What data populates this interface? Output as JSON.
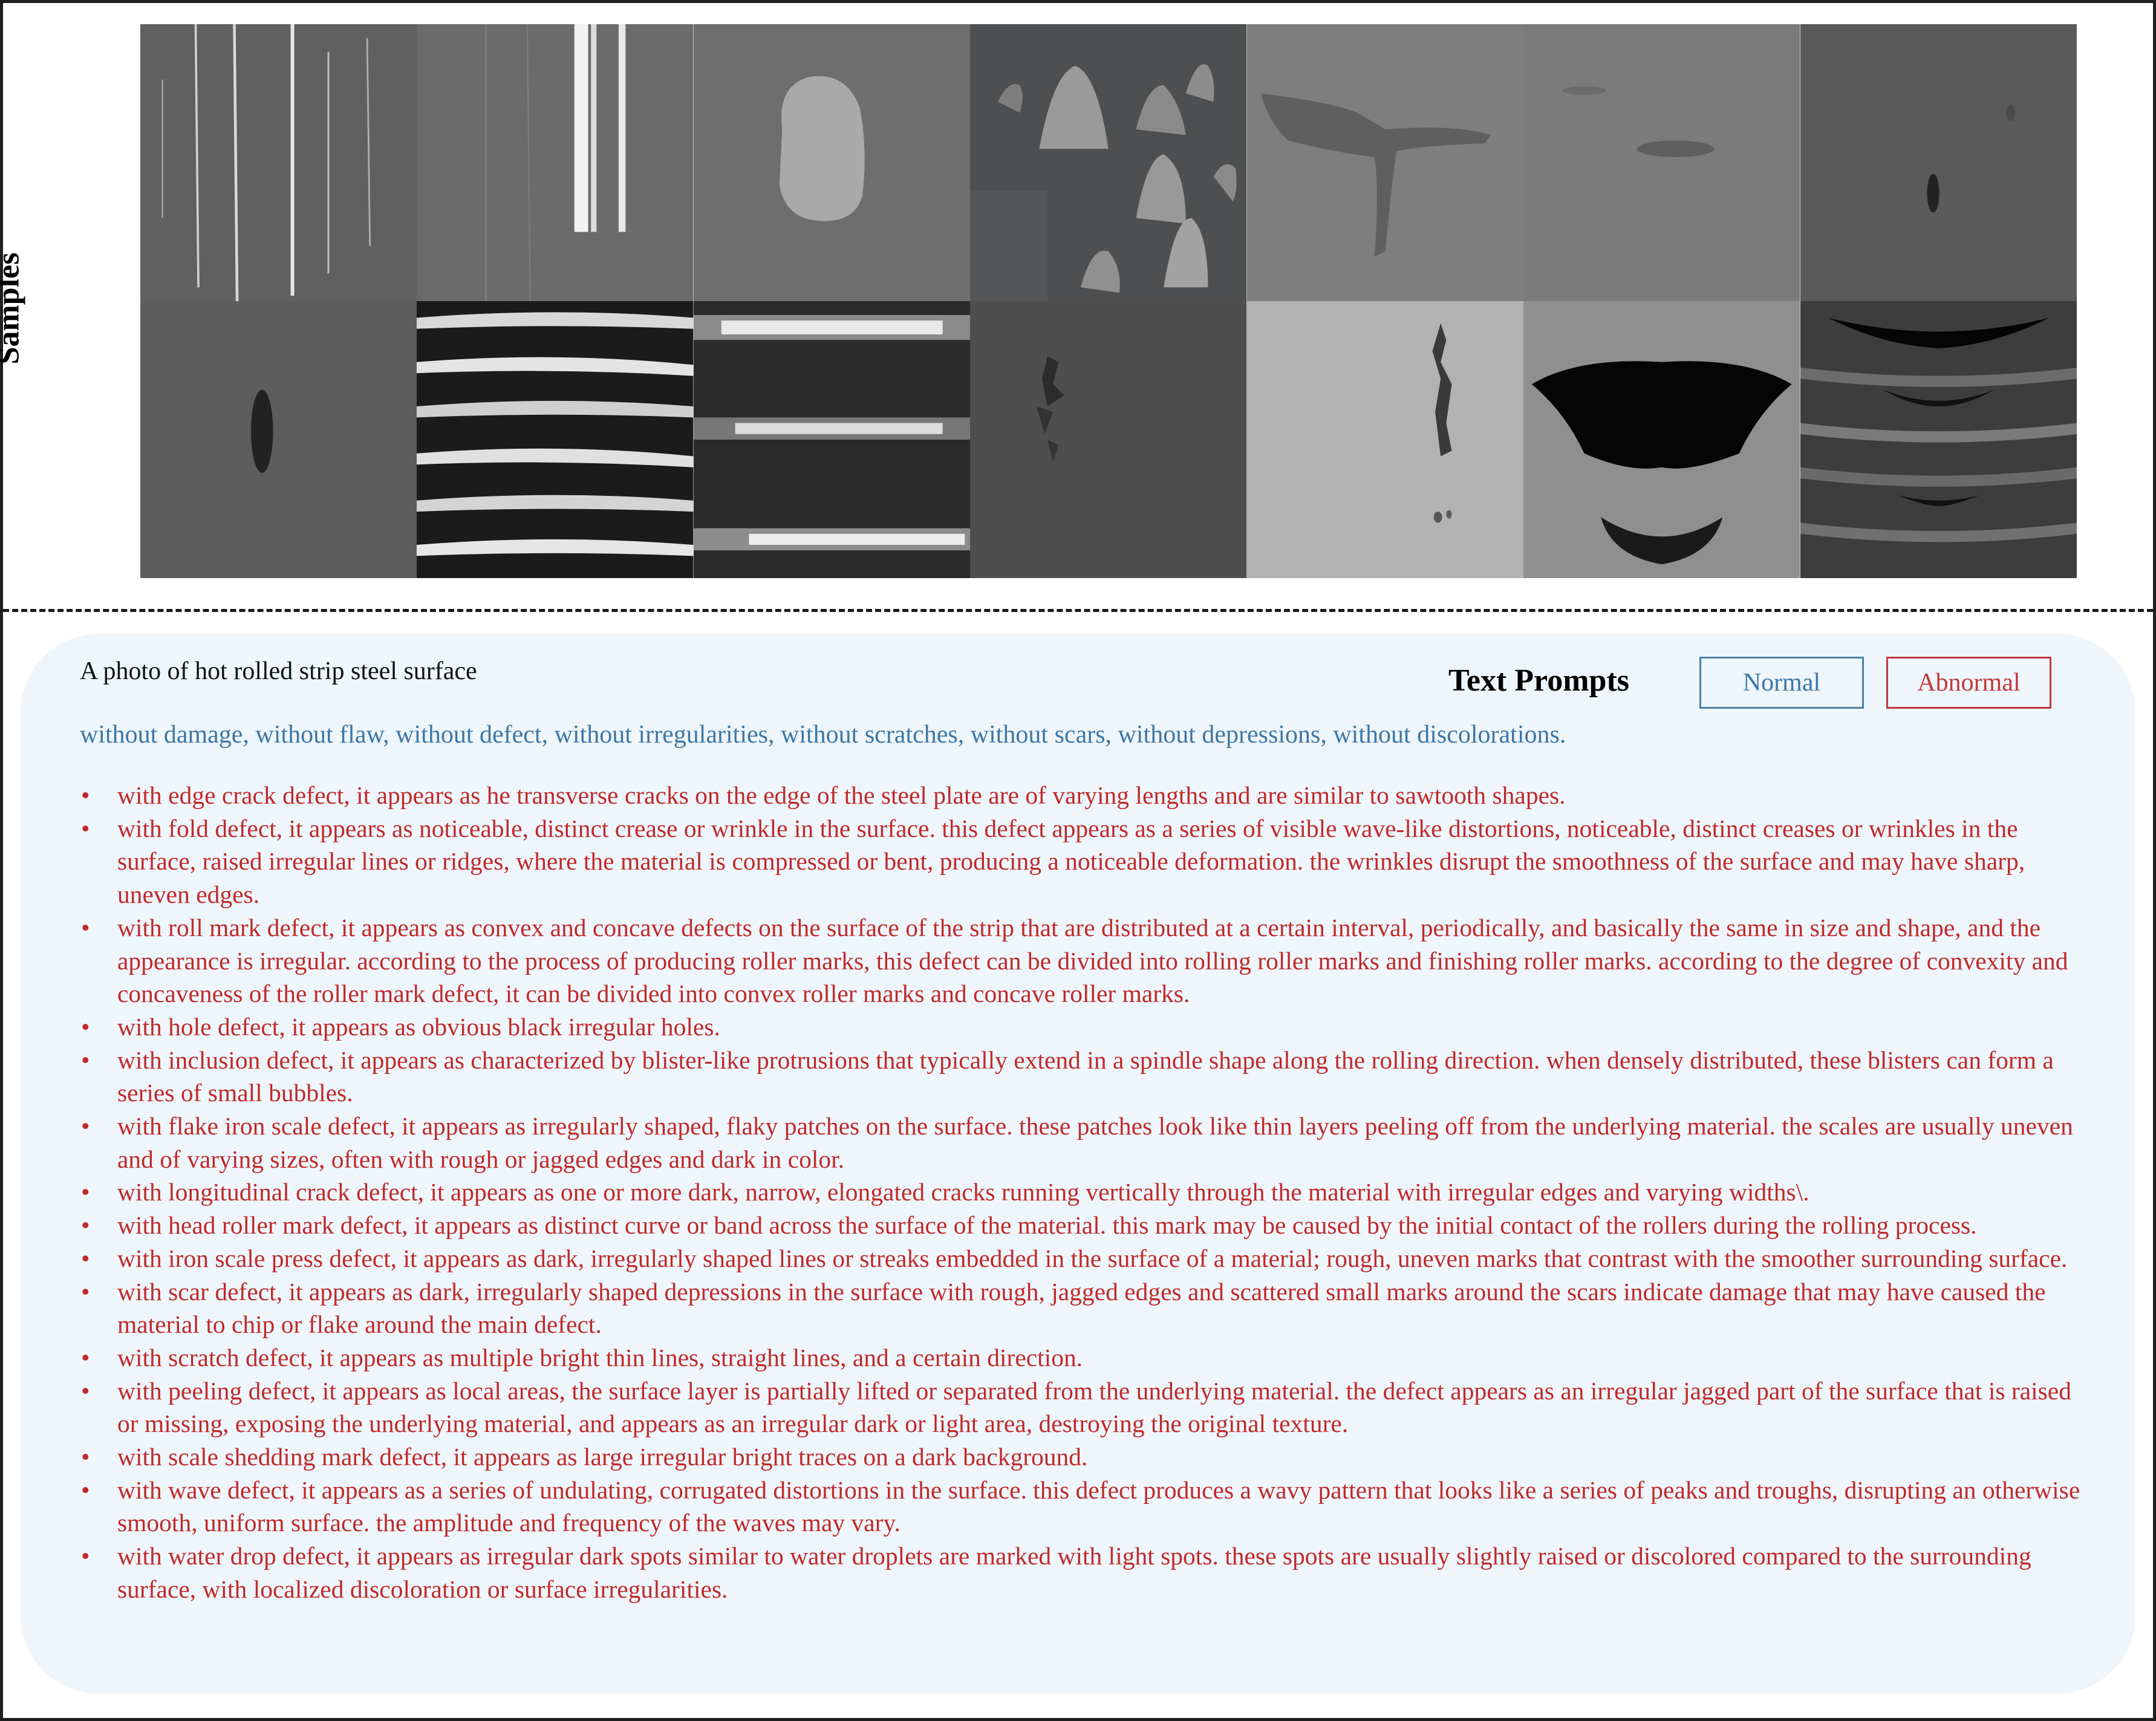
{
  "samples_label": "Samples",
  "sample_tiles": [
    {
      "row": 1,
      "col": 1,
      "kind": "thin-vertical-scratches"
    },
    {
      "row": 1,
      "col": 2,
      "kind": "bright-vertical-streaks"
    },
    {
      "row": 1,
      "col": 3,
      "kind": "light-patch"
    },
    {
      "row": 1,
      "col": 4,
      "kind": "scale-shedding-blotches"
    },
    {
      "row": 1,
      "col": 5,
      "kind": "dark-curved-mark"
    },
    {
      "row": 1,
      "col": 6,
      "kind": "faint-dark-streak"
    },
    {
      "row": 1,
      "col": 7,
      "kind": "small-dark-hole"
    },
    {
      "row": 2,
      "col": 1,
      "kind": "dark-spindle-spot"
    },
    {
      "row": 2,
      "col": 2,
      "kind": "wave-bands"
    },
    {
      "row": 2,
      "col": 3,
      "kind": "roll-mark-bands"
    },
    {
      "row": 2,
      "col": 4,
      "kind": "dark-flaky-patches"
    },
    {
      "row": 2,
      "col": 5,
      "kind": "crack-on-light-surface"
    },
    {
      "row": 2,
      "col": 6,
      "kind": "large-black-hole"
    },
    {
      "row": 2,
      "col": 7,
      "kind": "fold-wrinkles"
    }
  ],
  "prompt_prefix": "A photo of hot rolled strip steel surface",
  "text_prompts_title": "Text Prompts",
  "legend": {
    "normal_label": "Normal",
    "abnormal_label": "Abnormal",
    "normal_color": "#3e76a6",
    "abnormal_color": "#c0393b"
  },
  "normal_text": "without damage, without flaw, without defect, without irregularities, without scratches, without scars, without depressions, without discolorations.",
  "abnormal_items": [
    "with edge crack defect, it appears as  he transverse cracks on the edge of the steel plate are of varying lengths and are similar to sawtooth shapes.",
    "with fold defect, it appears as  noticeable, distinct crease or wrinkle in the surface. this defect appears as a series of visible wave-like distortions, noticeable, distinct creases or wrinkles in the surface, raised irregular lines or ridges, where the material is compressed or bent, producing a noticeable deformation. the wrinkles disrupt the smoothness of the surface and may have sharp, uneven edges.",
    "with roll mark defect, it appears as  convex and concave defects on the surface of the strip that are distributed at a certain interval, periodically, and basically the same in size and shape, and the appearance is irregular. according to the process of producing roller marks, this defect can be divided into rolling roller marks and finishing roller marks. according to the degree of convexity and concaveness of the roller mark defect, it can be divided into convex roller marks and concave roller marks.",
    "with hole defect, it appears as  obvious black irregular holes.",
    "with inclusion defect, it appears as  characterized by blister-like protrusions that typically extend in a spindle shape along the rolling direction. when densely distributed, these blisters can form a series of small bubbles.",
    "with flake iron scale defect, it appears as  irregularly shaped, flaky patches on the surface. these patches look like thin layers peeling off from the underlying material. the scales are usually uneven and of varying sizes, often with rough or jagged edges and dark in color.",
    "with longitudinal crack defect, it appears as  one or more dark, narrow, elongated cracks running vertically through the material with irregular edges and varying widths\\.",
    "with head roller mark defect, it appears as  distinct curve or band across the surface of the material. this mark may be caused by the initial contact of the rollers during the rolling process.",
    "with iron scale press defect, it appears as  dark, irregularly shaped lines or streaks embedded in the surface of a material; rough, uneven marks that contrast with the smoother surrounding surface.",
    "with scar defect, it appears as  dark, irregularly shaped depressions in the surface with rough, jagged edges and scattered small marks around the scars indicate damage that may have caused the material to chip or flake around the main defect.",
    "with scratch defect, it appears as  multiple bright thin lines, straight lines, and a certain direction.",
    "with peeling defect, it appears as  local areas, the surface layer is partially lifted or separated from the underlying material. the defect appears as an irregular jagged part of the surface that is raised or missing, exposing the underlying material, and appears as an irregular dark or light area, destroying the original texture.",
    "with scale shedding mark defect, it appears as  large irregular bright traces on a dark background.",
    "with wave defect, it appears as  a series of undulating, corrugated distortions in the surface. this defect produces a wavy pattern that looks like a series of peaks and troughs, disrupting an otherwise smooth, uniform surface. the amplitude and frequency of the waves may vary.",
    "with water drop defect, it appears as  irregular dark spots similar to water droplets are marked with light spots. these spots are usually slightly raised or discolored compared to the surrounding surface, with localized discoloration or surface irregularities."
  ]
}
